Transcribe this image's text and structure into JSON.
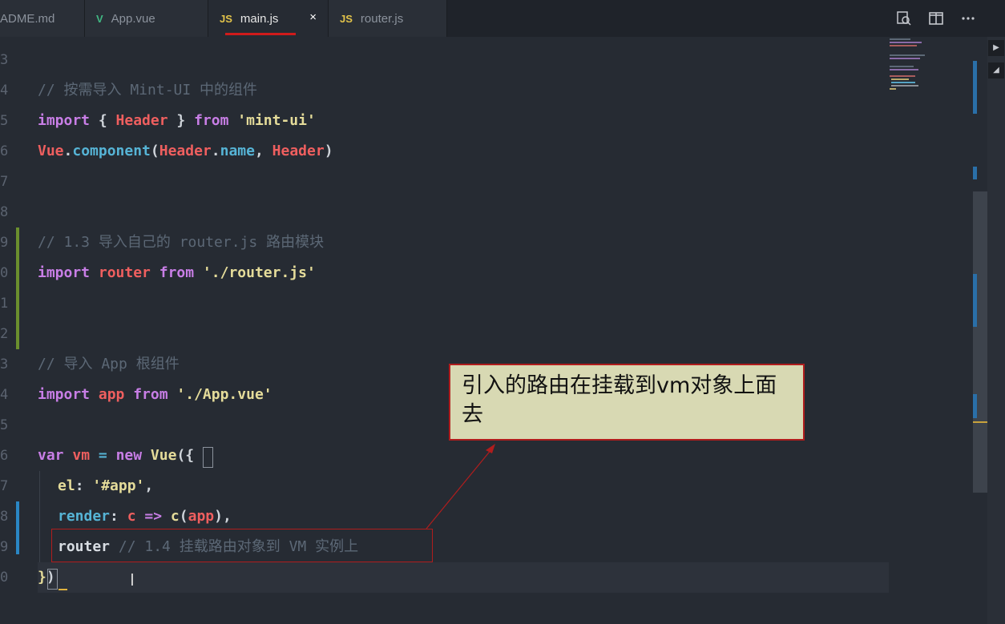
{
  "tabs": [
    {
      "label": "ADME.md",
      "icon": ""
    },
    {
      "label": "App.vue",
      "icon": "vue-icon"
    },
    {
      "label": "main.js",
      "icon": "js-icon",
      "active": true
    },
    {
      "label": "router.js",
      "icon": "js-icon"
    }
  ],
  "tab_icon_js": "JS",
  "tab_icon_vue": "V",
  "close_glyph": "×",
  "line_numbers": [
    "3",
    "4",
    "5",
    "6",
    "7",
    "8",
    "9",
    "0",
    "1",
    "2",
    "3",
    "4",
    "5",
    "6",
    "7",
    "8",
    "9",
    "0"
  ],
  "code": {
    "l4_comment": "// 按需导入 Mint-UI 中的组件",
    "l5": {
      "kw1": "import",
      "p1": " { ",
      "name": "Header",
      "p2": " } ",
      "kw2": "from",
      "str": " 'mint-ui'"
    },
    "l6": {
      "obj": "Vue",
      "dot": ".",
      "fn": "component",
      "p1": "(",
      "a1": "Header",
      "dot2": ".",
      "prop": "name",
      "comma": ", ",
      "a2": "Header",
      "p2": ")"
    },
    "l9_comment": "// 1.3 导入自己的 router.js 路由模块",
    "l10": {
      "kw1": "import",
      "name": " router ",
      "kw2": "from",
      "str": " './router.js'"
    },
    "l13_comment": "// 导入 App 根组件",
    "l14": {
      "kw1": "import",
      "name": " app ",
      "kw2": "from",
      "str": " './App.vue'"
    },
    "l16": {
      "kw1": "var",
      "name": " vm ",
      "op": "= ",
      "kw2": "new",
      "cls": " Vue",
      "p1": "(",
      "p2": "{"
    },
    "l17": {
      "key": "el",
      "colon": ": ",
      "str": "'#app'",
      "comma": ","
    },
    "l18": {
      "key": "render",
      "colon": ": ",
      "param": "c",
      "arrow": " => ",
      "fn": "c",
      "p1": "(",
      "arg": "app",
      "p2": ")",
      "comma": ","
    },
    "l19": {
      "key": "router",
      "comment": " // 1.4 挂载路由对象到 VM 实例上"
    },
    "l20": {
      "p1": "}",
      "p2": ")"
    }
  },
  "callout_text": "引入的路由在挂载到vm对象上面去",
  "colors": {
    "accent_underline": "#d01b1b",
    "callout_bg": "#d8d9b3",
    "callout_border": "#b01d1d"
  }
}
